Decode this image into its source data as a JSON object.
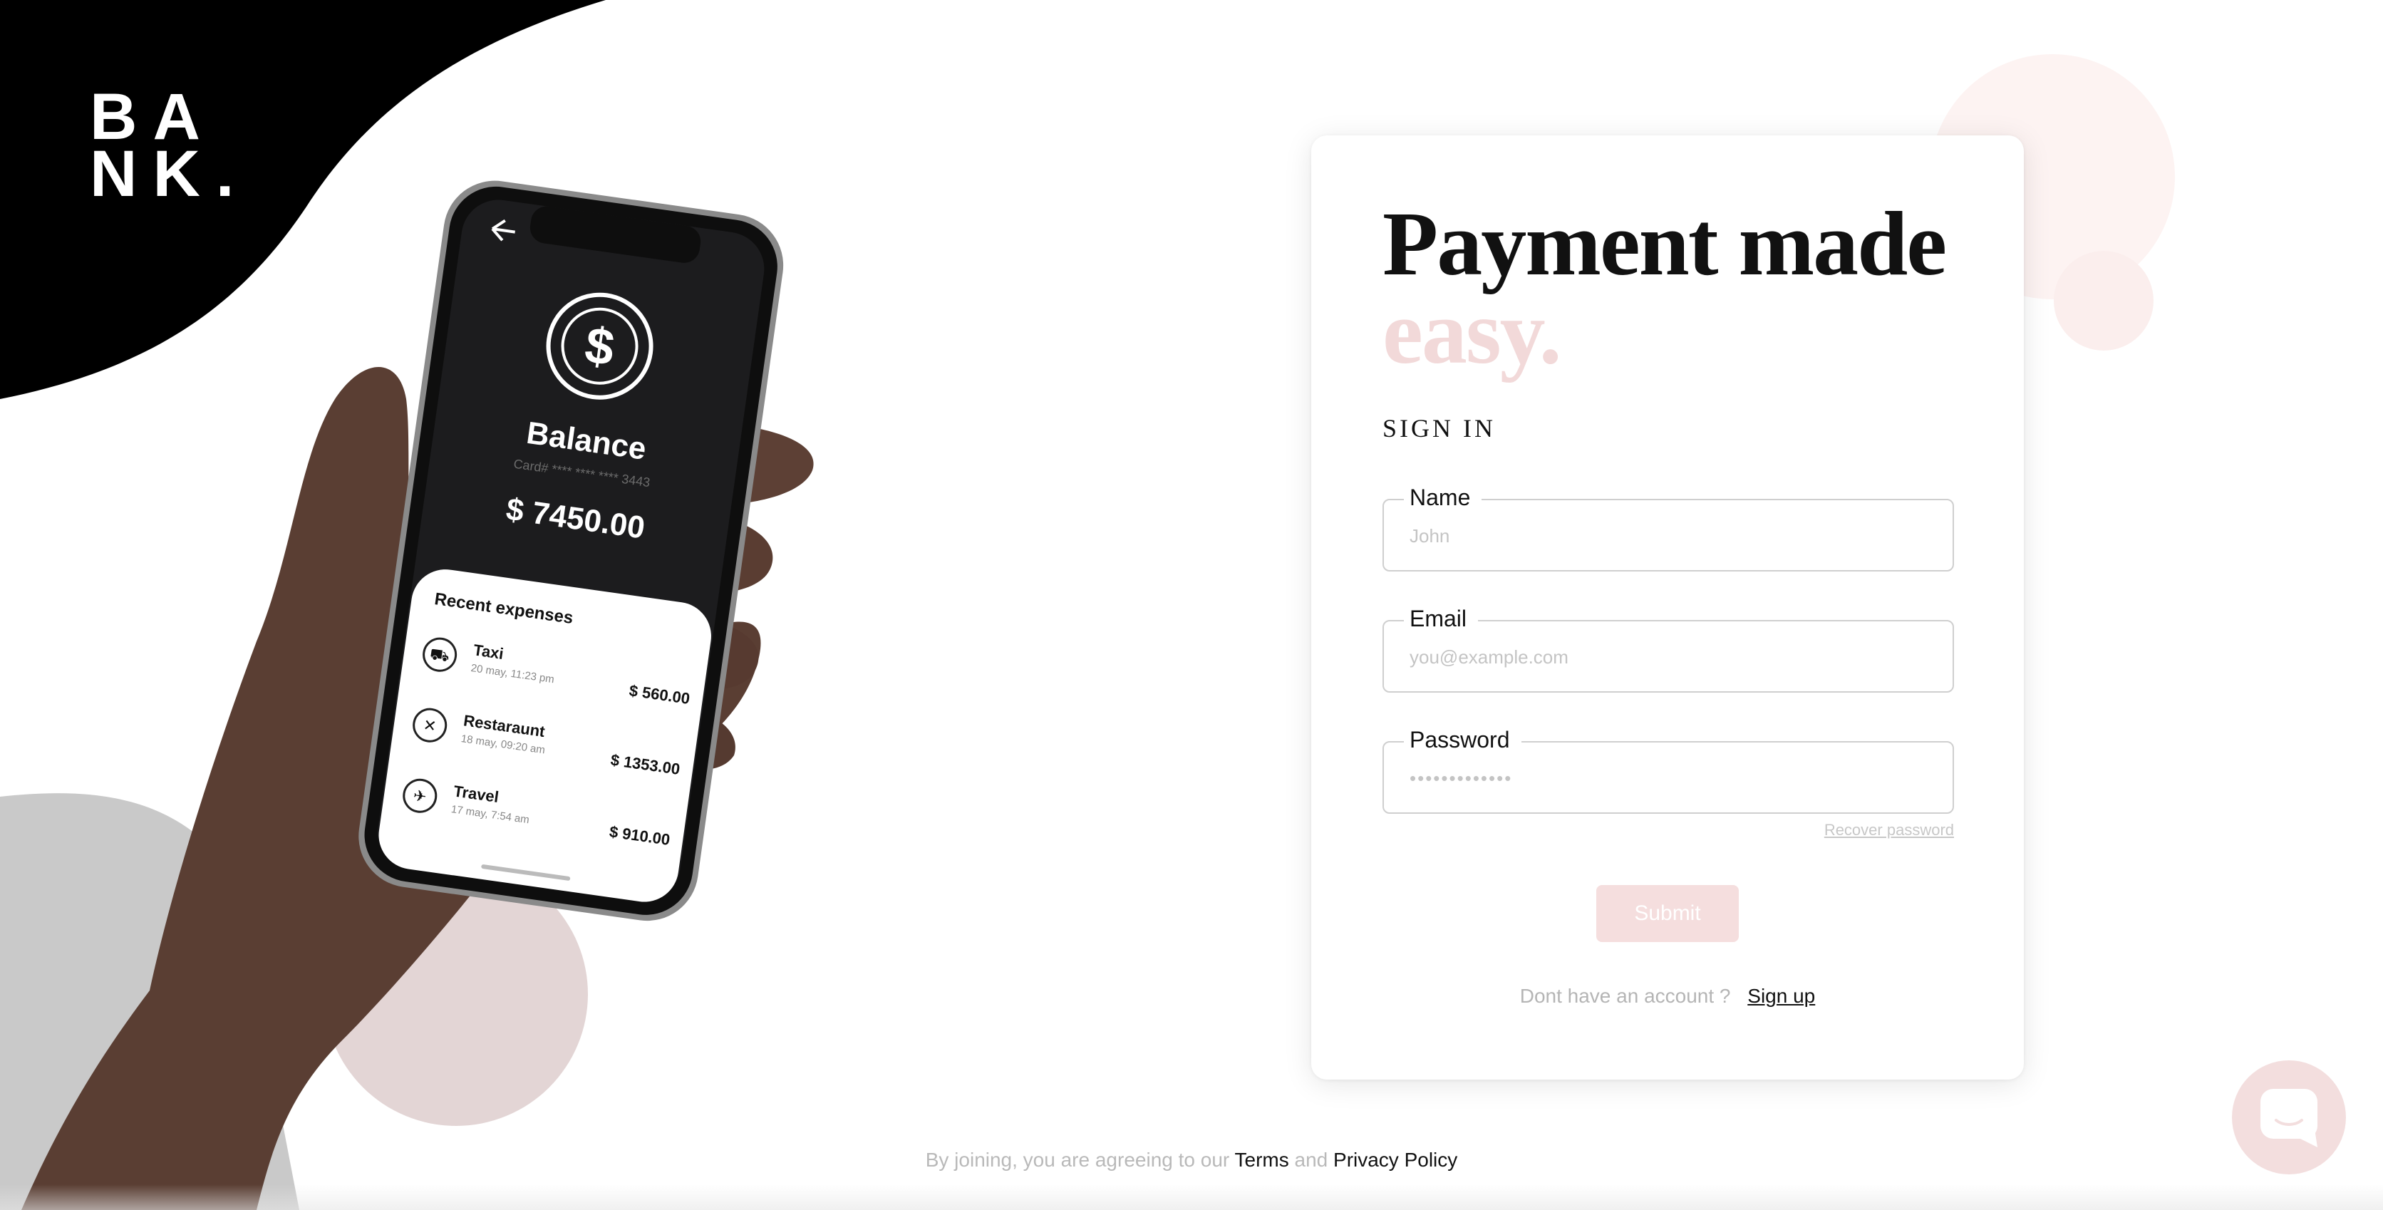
{
  "brand": {
    "line1": "BA",
    "line2": "NK."
  },
  "phone_screen": {
    "balance_label": "Balance",
    "card_label": "Card#  ****  ****  ****  3443",
    "balance_amount": "$ 7450.00",
    "recent_title": "Recent expenses",
    "expenses": [
      {
        "name": "Taxi",
        "date": "20 may, 11:23 pm",
        "amount": "$ 560.00",
        "icon": "car-icon"
      },
      {
        "name": "Restaraunt",
        "date": "18 may, 09:20 am",
        "amount": "$ 1353.00",
        "icon": "cutlery-icon"
      },
      {
        "name": "Travel",
        "date": "17 may, 7:54 am",
        "amount": "$ 910.00",
        "icon": "plane-icon"
      }
    ]
  },
  "form": {
    "headline_line1": "Payment made",
    "headline_line2": "easy.",
    "section_title": "SIGN IN",
    "name_label": "Name",
    "name_placeholder": "John",
    "email_label": "Email",
    "email_placeholder": "you@example.com",
    "password_label": "Password",
    "password_placeholder": "•••••••••••••",
    "recover_label": "Recover password",
    "submit_label": "Submit",
    "no_account_text": "Dont have an account ?",
    "signup_label": "Sign up"
  },
  "footer": {
    "prefix": "By joining, you are agreeing to our",
    "terms": "Terms",
    "and": "and",
    "privacy": "Privacy Policy"
  },
  "colors": {
    "accent_pink": "#f5dede",
    "headline_pink": "#f2d9d9",
    "ink": "#111111"
  },
  "chat_widget": {
    "icon": "chat-icon"
  }
}
